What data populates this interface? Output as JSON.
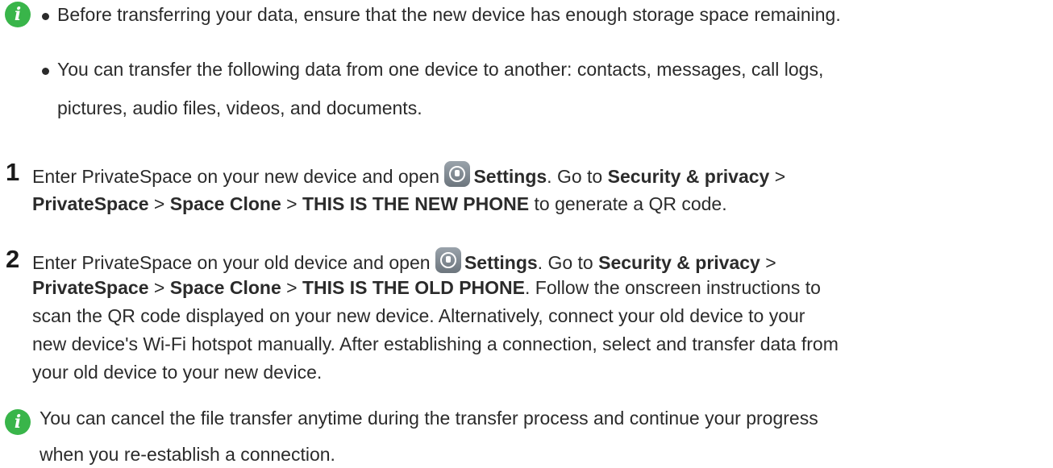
{
  "note_top": {
    "icon": "info-icon",
    "bullets": [
      "Before transferring your data, ensure that the new device has enough storage space remaining.",
      "You can transfer the following data from one device to another: contacts, messages, call logs,",
      "pictures, audio files, videos, and documents."
    ]
  },
  "steps": [
    {
      "number": "1",
      "line1_prefix": "Enter PrivateSpace on your new device and open",
      "settings_label": "Settings",
      "goto": ". Go to",
      "security": "Security & privacy",
      "sep": ">",
      "private_space": "PrivateSpace",
      "space_clone": "Space Clone",
      "phone_label": "THIS IS THE NEW PHONE",
      "line2_suffix": "to generate a QR code."
    },
    {
      "number": "2",
      "line1_prefix": "Enter PrivateSpace on your old device and open",
      "settings_label": "Settings",
      "goto": ". Go to",
      "security": "Security & privacy",
      "sep": ">",
      "private_space": "PrivateSpace",
      "space_clone": "Space Clone",
      "phone_label": "THIS IS THE OLD PHONE",
      "line2_suffix": ". Follow the onscreen instructions to",
      "lines": [
        "scan the QR code displayed on your new device. Alternatively, connect your old device to your",
        "new device's Wi-Fi hotspot manually. After establishing a connection, select and transfer data from",
        "your old device to your new device."
      ]
    }
  ],
  "note_bottom": {
    "icon": "info-icon",
    "lines": [
      "You can cancel the file transfer anytime during the transfer process and continue your progress",
      "when you re-establish a connection."
    ]
  }
}
